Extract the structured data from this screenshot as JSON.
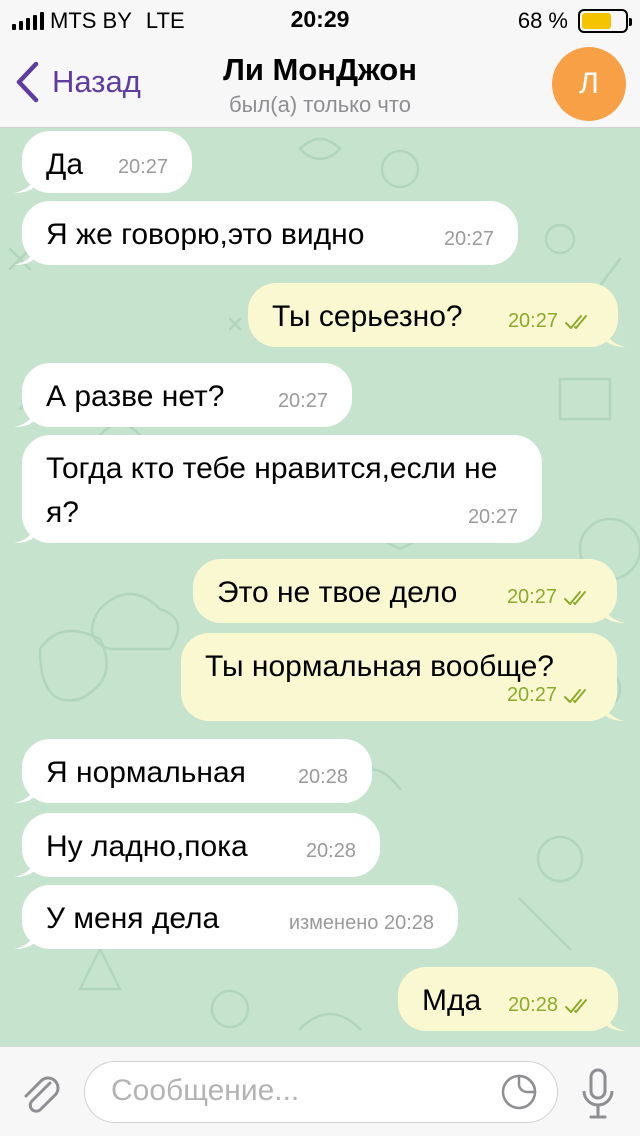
{
  "status_bar": {
    "carrier": "MTS BY",
    "network": "LTE",
    "time": "20:29",
    "battery_percent": "68 %",
    "battery_level": 0.68
  },
  "header": {
    "back_label": "Назад",
    "title": "Ли МонДжон",
    "subtitle": "был(а) только что",
    "avatar_letter": "Л",
    "avatar_color": "#f7a046"
  },
  "messages": [
    {
      "direction": "in",
      "text": "Да",
      "time": "20:27"
    },
    {
      "direction": "in",
      "text": "Я же говорю,это видно",
      "time": "20:27"
    },
    {
      "direction": "out",
      "text": "Ты серьезно?",
      "time": "20:27"
    },
    {
      "direction": "in",
      "text": "А разве нет?",
      "time": "20:27"
    },
    {
      "direction": "in",
      "text": "Тогда кто тебе нравится,если не я?",
      "time": "20:27"
    },
    {
      "direction": "out",
      "text": "Это не твое дело",
      "time": "20:27"
    },
    {
      "direction": "out",
      "text": "Ты нормальная вообще?",
      "time": "20:27"
    },
    {
      "direction": "in",
      "text": "Я нормальная",
      "time": "20:28"
    },
    {
      "direction": "in",
      "text": "Ну ладно,пока",
      "time": "20:28"
    },
    {
      "direction": "in",
      "text": "У меня дела",
      "time": "изменено 20:28"
    },
    {
      "direction": "out",
      "text": "Мда",
      "time": "20:28"
    }
  ],
  "composer": {
    "placeholder": "Сообщение..."
  },
  "colors": {
    "accent": "#5e3ca0",
    "chat_background": "#c5e3cd",
    "incoming_bubble": "#ffffff",
    "outgoing_bubble": "#f9f8d0",
    "outgoing_meta": "#8bab2c"
  }
}
